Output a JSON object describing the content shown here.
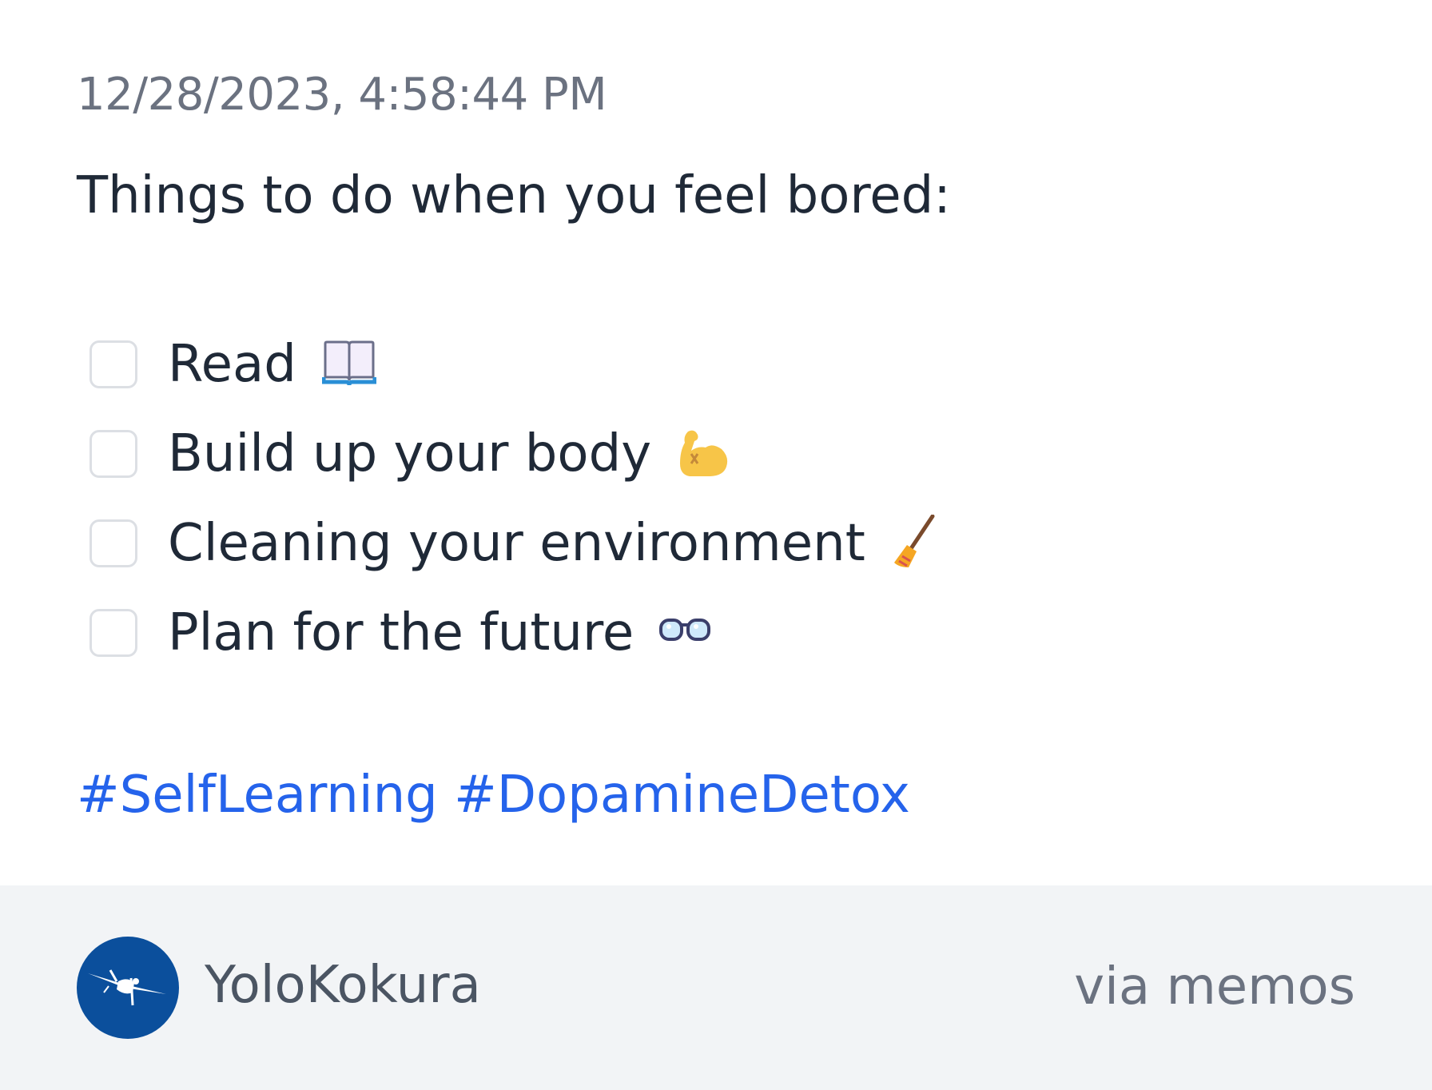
{
  "memo": {
    "timestamp": "12/28/2023, 4:58:44 PM",
    "heading": "Things to do when you feel bored:",
    "tasks": [
      {
        "label": "Read",
        "icon": "book-icon",
        "checked": false
      },
      {
        "label": "Build up your body",
        "icon": "flexed-biceps-icon",
        "checked": false
      },
      {
        "label": "Cleaning your environment",
        "icon": "broom-icon",
        "checked": false
      },
      {
        "label": "Plan for the future",
        "icon": "glasses-icon",
        "checked": false
      }
    ],
    "tags": [
      "#SelfLearning",
      "#DopamineDetox"
    ]
  },
  "footer": {
    "username": "YoloKokura",
    "via": "via memos",
    "avatar_icon": "airplane-avatar-icon"
  },
  "colors": {
    "text": "#1f2937",
    "muted": "#6b7280",
    "tag": "#2563eb",
    "footer_bg": "#f2f4f6",
    "avatar_bg": "#0b4f9c"
  }
}
